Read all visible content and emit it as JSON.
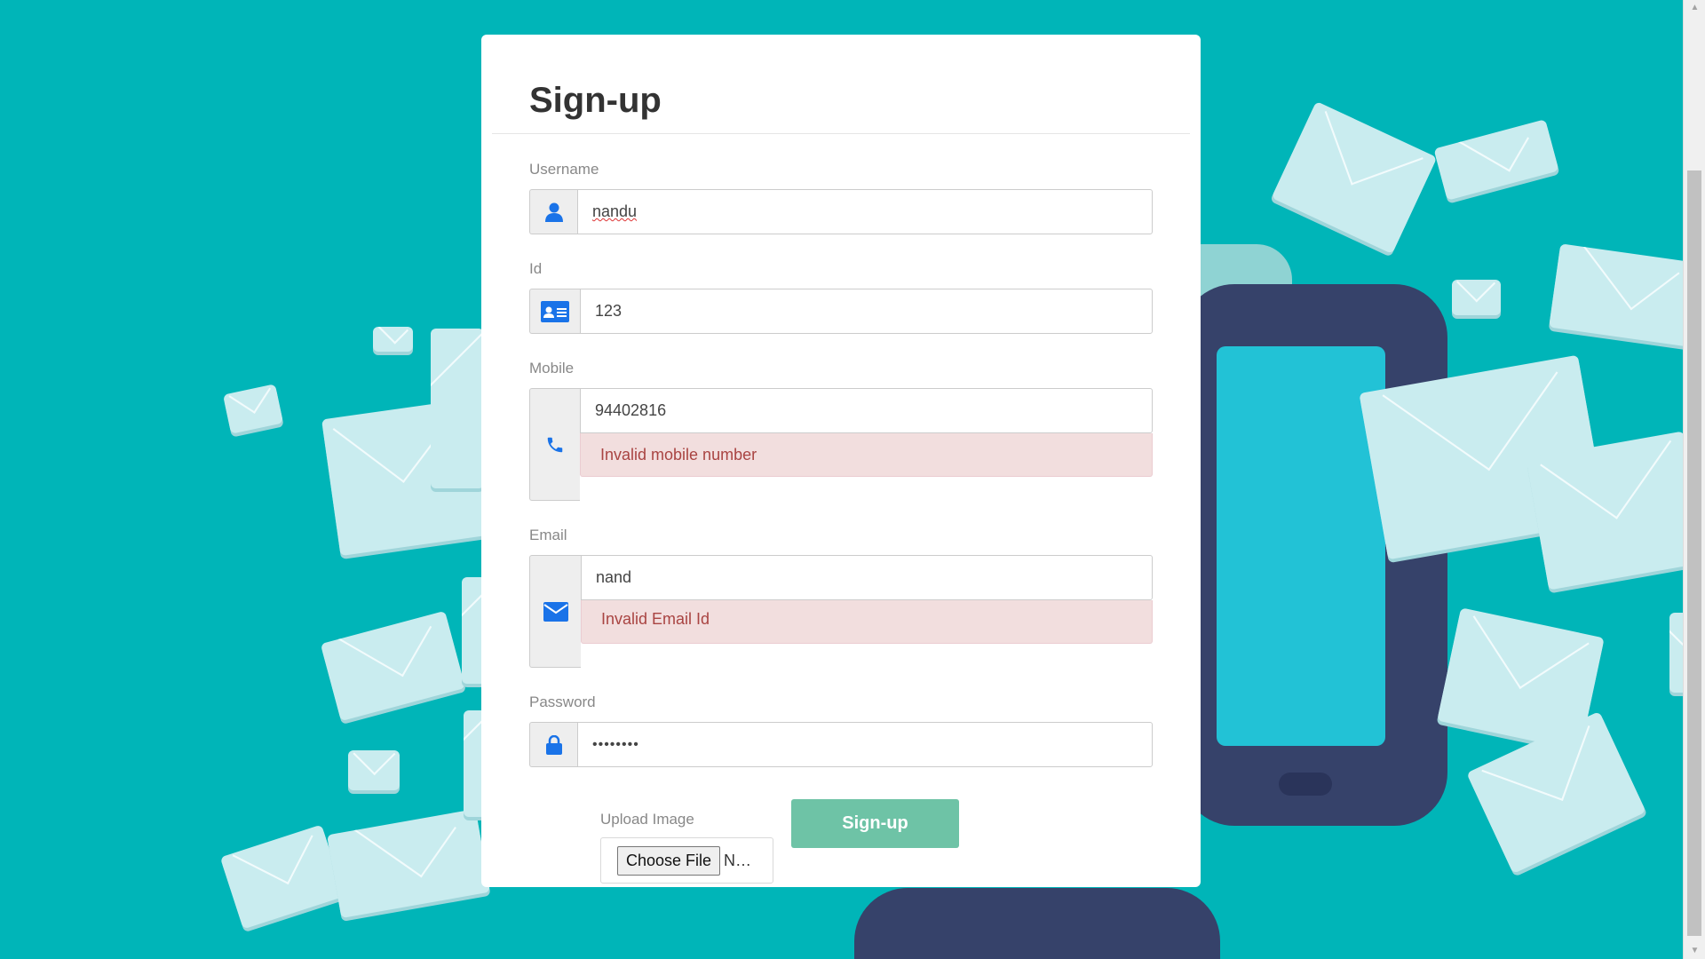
{
  "form": {
    "title": "Sign-up",
    "username": {
      "label": "Username",
      "value": "nandu",
      "icon": "user-icon"
    },
    "id": {
      "label": "Id",
      "value": "123",
      "icon": "id-card-icon"
    },
    "mobile": {
      "label": "Mobile",
      "value": "94402816",
      "error": "Invalid mobile number",
      "icon": "phone-icon"
    },
    "email": {
      "label": "Email",
      "value": "nand",
      "error": "Invalid Email Id",
      "icon": "envelope-icon"
    },
    "password": {
      "label": "Password",
      "value": "••••••••",
      "icon": "lock-icon"
    },
    "upload": {
      "label": "Upload Image",
      "button_label": "Choose File",
      "file_status": "N…"
    },
    "submit_label": "Sign-up"
  },
  "colors": {
    "background": "#00b5b8",
    "icon_accent": "#1a73e8",
    "error_text": "#a94442",
    "error_bg": "#f2dede",
    "submit_button": "#6ec3a6"
  }
}
